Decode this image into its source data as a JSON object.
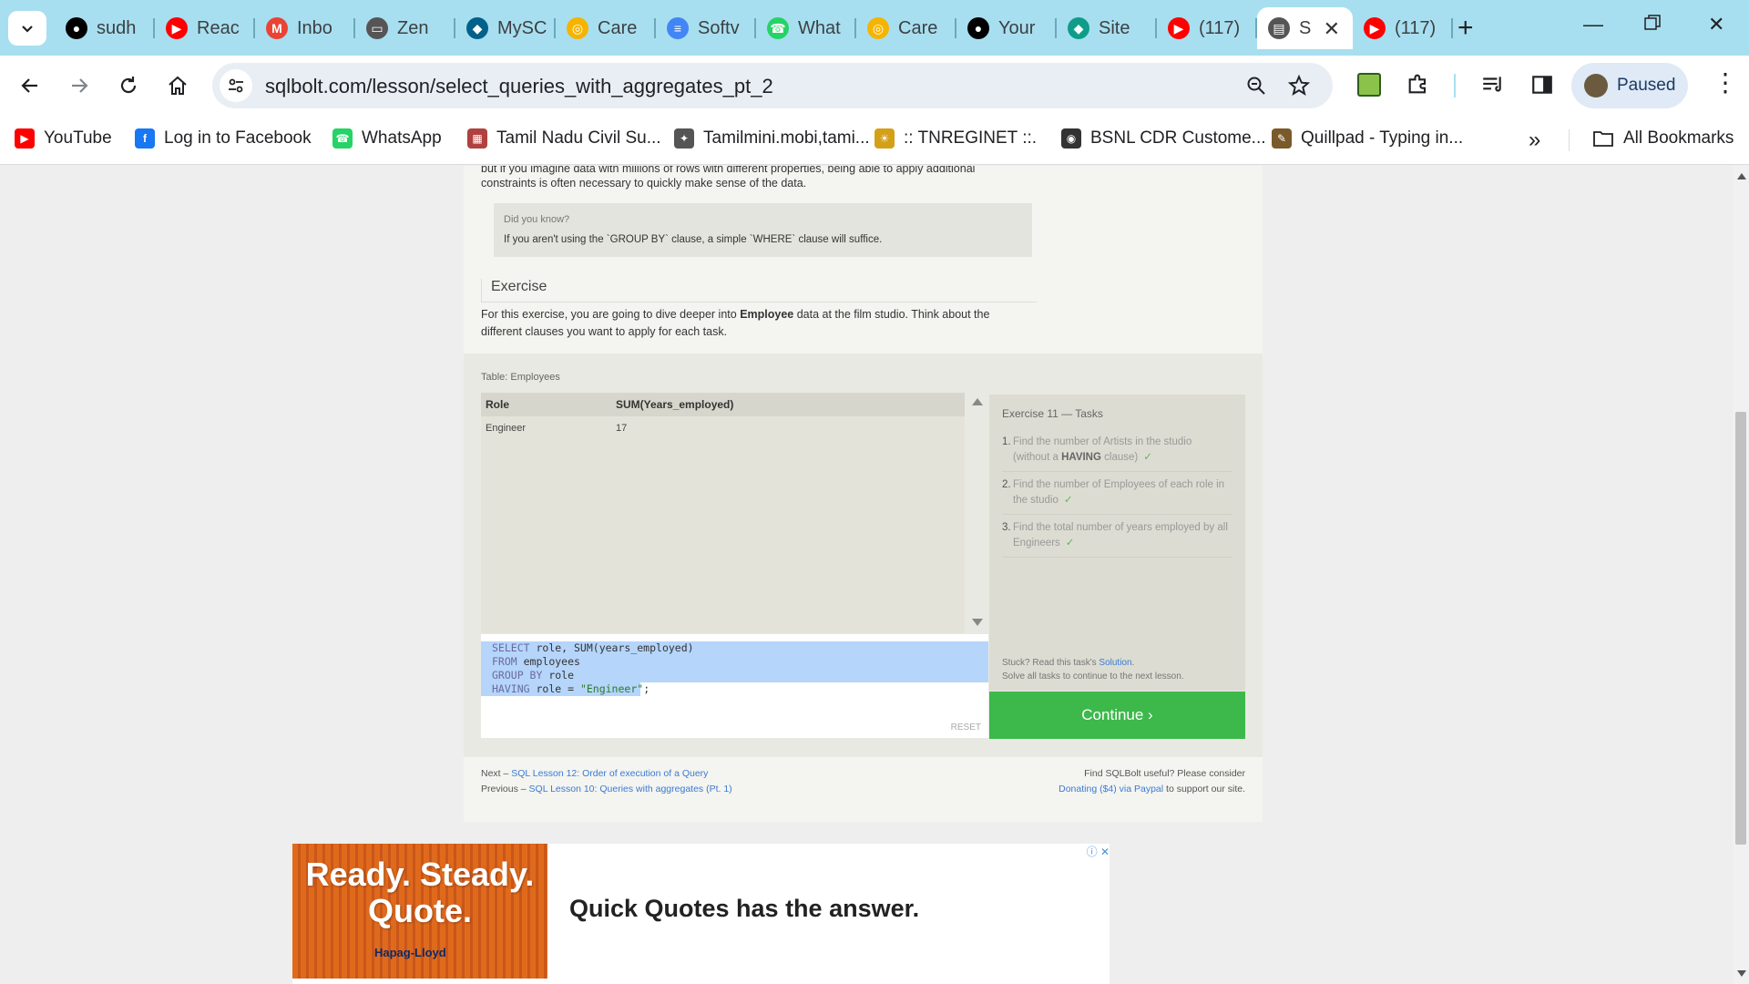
{
  "tabs": [
    {
      "title": "sudh",
      "icon": "github-icon",
      "color": "#000000"
    },
    {
      "title": "Reac",
      "icon": "youtube-icon",
      "color": "#ff0000"
    },
    {
      "title": "Inbo",
      "icon": "gmail-icon",
      "color": "#ea4335"
    },
    {
      "title": "Zen",
      "icon": "classroom-icon",
      "color": "#555555"
    },
    {
      "title": "MySC",
      "icon": "mysql-icon",
      "color": "#00618a"
    },
    {
      "title": "Care",
      "icon": "app-icon",
      "color": "#f4b400"
    },
    {
      "title": "Softv",
      "icon": "doc-icon",
      "color": "#4285f4"
    },
    {
      "title": "What",
      "icon": "whatsapp-icon",
      "color": "#25d366"
    },
    {
      "title": "Care",
      "icon": "app-icon",
      "color": "#f4b400"
    },
    {
      "title": "Your",
      "icon": "github-icon",
      "color": "#000000"
    },
    {
      "title": "Site",
      "icon": "diamond-icon",
      "color": "#0f9d8a"
    },
    {
      "title": "(117)",
      "icon": "youtube-icon",
      "color": "#ff0000"
    },
    {
      "title": "S",
      "icon": "database-icon",
      "color": "#555555",
      "active": true
    },
    {
      "title": "(117)",
      "icon": "youtube-icon",
      "color": "#ff0000"
    }
  ],
  "toolbar": {
    "url": "sqlbolt.com/lesson/select_queries_with_aggregates_pt_2",
    "profile_status": "Paused"
  },
  "bookmarks": [
    {
      "label": "YouTube",
      "icon": "youtube-icon",
      "color": "#ff0000"
    },
    {
      "label": "Log in to Facebook",
      "icon": "facebook-icon",
      "color": "#1877f2"
    },
    {
      "label": "WhatsApp",
      "icon": "whatsapp-icon",
      "color": "#25d366"
    },
    {
      "label": "Tamil Nadu Civil Su...",
      "icon": "tn-civil-icon",
      "color": "#b0413e"
    },
    {
      "label": "Tamilmini.mobi,tami...",
      "icon": "tamilmini-icon",
      "color": "#555555"
    },
    {
      "label": ":: TNREGINET ::.",
      "icon": "emblem-icon",
      "color": "#d4a017"
    },
    {
      "label": "BSNL CDR Custome...",
      "icon": "globe-icon",
      "color": "#333333"
    },
    {
      "label": "Quillpad - Typing in...",
      "icon": "quillpad-icon",
      "color": "#7a5a2a"
    }
  ],
  "bookmarks_all": "All Bookmarks",
  "lesson": {
    "intro_line1": "but if you imagine data with millions of rows with different properties, being able to apply additional",
    "intro_line2": "constraints is often necessary to quickly make sense of the data.",
    "did_you_know_heading": "Did you know?",
    "did_you_know_body": "If you aren't using the `GROUP BY` clause, a simple `WHERE` clause will suffice.",
    "exercise_heading": "Exercise",
    "exercise_text_before": "For this exercise, you are going to dive deeper into ",
    "exercise_text_bold": "Employee",
    "exercise_text_after": " data at the film studio. Think about the",
    "exercise_text_line2": "different clauses you want to apply for each task."
  },
  "exercise": {
    "table_label": "Table: Employees",
    "columns": [
      "Role",
      "SUM(Years_employed)"
    ],
    "rows": [
      [
        "Engineer",
        "17"
      ]
    ],
    "code": {
      "l1_kw": "SELECT",
      "l1_rest": " role, SUM(years_employed)",
      "l2_kw": "FROM",
      "l2_rest": " employees",
      "l3_kw": "GROUP BY",
      "l3_rest": " role",
      "l4_kw": "HAVING",
      "l4_mid": " role = ",
      "l4_str": "\"Engineer\"",
      "l4_end": ";"
    },
    "reset_label": "RESET",
    "tasks_title": "Exercise 11 — Tasks",
    "tasks": [
      {
        "num": "1.",
        "text_a": "Find the number of Artists in the studio",
        "text_b_pre": "(without a ",
        "text_b_bold": "HAVING",
        "text_b_post": " clause)"
      },
      {
        "num": "2.",
        "text_a": "Find the number of Employees of each role in",
        "text_b_pre": "the studio",
        "text_b_bold": "",
        "text_b_post": ""
      },
      {
        "num": "3.",
        "text_a": "Find the total number of years employed by all",
        "text_b_pre": "Engineers",
        "text_b_bold": "",
        "text_b_post": ""
      }
    ],
    "check_mark": "✓",
    "stuck_pre": "Stuck? Read this task's ",
    "stuck_link": "Solution",
    "stuck_post": ".",
    "stuck_line2": "Solve all tasks to continue to the next lesson.",
    "continue_label": "Continue ›"
  },
  "footer": {
    "next_pre": "Next – ",
    "next_link": "SQL Lesson 12: Order of execution of a Query",
    "prev_pre": "Previous – ",
    "prev_link": "SQL Lesson 10: Queries with aggregates (Pt. 1)",
    "donate_line1": "Find SQLBolt useful? Please consider",
    "donate_link": "Donating ($4) via Paypal",
    "donate_post": " to support our site."
  },
  "ad": {
    "headline_1": "Ready. Steady.",
    "headline_2": "Quote.",
    "brand": "Hapag-Lloyd",
    "text": "Quick Quotes has the answer."
  }
}
